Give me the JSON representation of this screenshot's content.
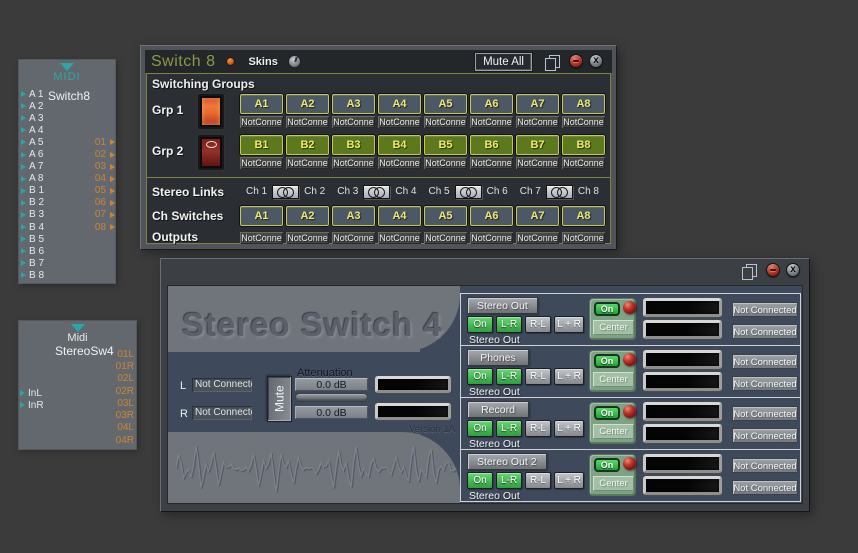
{
  "colors": {
    "desktop_bg": "#3b3b3b",
    "accent_olive": "#7e8140",
    "title_olive": "#8e9747",
    "button_yellow": "#efe96e",
    "group_b_green": "#5c7a1d",
    "channel_slate": "#4d5866",
    "port_teal": "#2aa5a8",
    "port_orange": "#cd8330",
    "panel_navy": "#3e4a5c",
    "window_gray": "#70757c",
    "sage_green": "#7fa285",
    "on_green": "#2f9e3e",
    "knob_red": "#8c0f16",
    "led_orange": "#d2590f"
  },
  "module_midi_switch8": {
    "header": "MIDI",
    "title": "Switch8",
    "rows": [
      {
        "in": "A 1",
        "out": ""
      },
      {
        "in": "A 2",
        "out": ""
      },
      {
        "in": "A 3",
        "out": ""
      },
      {
        "in": "A 4",
        "out": ""
      },
      {
        "in": "A 5",
        "out": "01"
      },
      {
        "in": "A 6",
        "out": "02"
      },
      {
        "in": "A 7",
        "out": "03"
      },
      {
        "in": "A 8",
        "out": "04"
      },
      {
        "in": "B 1",
        "out": "05"
      },
      {
        "in": "B 2",
        "out": "06"
      },
      {
        "in": "B 3",
        "out": "07"
      },
      {
        "in": "B 4",
        "out": "08"
      },
      {
        "in": "B 5",
        "out": ""
      },
      {
        "in": "B 6",
        "out": ""
      },
      {
        "in": "B 7",
        "out": ""
      },
      {
        "in": "B 8",
        "out": ""
      }
    ]
  },
  "module_midi_stereosw4": {
    "header": "Midi",
    "title": "StereoSw4",
    "inputs": [
      {
        "label": "InL"
      },
      {
        "label": "InR"
      }
    ],
    "outputs": [
      {
        "label": "01L"
      },
      {
        "label": "01R"
      },
      {
        "label": "02L"
      },
      {
        "label": "02R"
      },
      {
        "label": "03L"
      },
      {
        "label": "03R"
      },
      {
        "label": "04L"
      },
      {
        "label": "04R"
      }
    ]
  },
  "switch8": {
    "title": "Switch 8",
    "skins_label": "Skins",
    "mute_all_label": "Mute All",
    "sections": {
      "switching_groups": "Switching Groups",
      "grp1": "Grp 1",
      "grp2": "Grp 2",
      "stereo_links": "Stereo Links",
      "ch_switches": "Ch Switches",
      "outputs": "Outputs"
    },
    "channels": [
      {
        "a": "A1",
        "conn_a": "NotConne",
        "b": "B1",
        "conn_b": "NotConne",
        "sw": "A1",
        "conn_out": "NotConne"
      },
      {
        "a": "A2",
        "conn_a": "NotConne",
        "b": "B2",
        "conn_b": "NotConne",
        "sw": "A2",
        "conn_out": "NotConne"
      },
      {
        "a": "A3",
        "conn_a": "NotConne",
        "b": "B3",
        "conn_b": "NotConne",
        "sw": "A3",
        "conn_out": "NotConne"
      },
      {
        "a": "A4",
        "conn_a": "NotConne",
        "b": "B4",
        "conn_b": "NotConne",
        "sw": "A4",
        "conn_out": "NotConne"
      },
      {
        "a": "A5",
        "conn_a": "NotConne",
        "b": "B5",
        "conn_b": "NotConne",
        "sw": "A5",
        "conn_out": "NotConne"
      },
      {
        "a": "A6",
        "conn_a": "NotConne",
        "b": "B6",
        "conn_b": "NotConne",
        "sw": "A6",
        "conn_out": "NotConne"
      },
      {
        "a": "A7",
        "conn_a": "NotConne",
        "b": "B7",
        "conn_b": "NotConne",
        "sw": "A7",
        "conn_out": "NotConne"
      },
      {
        "a": "A8",
        "conn_a": "NotConne",
        "b": "B8",
        "conn_b": "NotConne",
        "sw": "A8",
        "conn_out": "NotConne"
      }
    ],
    "links": [
      {
        "l": "Ch 1",
        "r": "Ch 2"
      },
      {
        "l": "Ch 3",
        "r": "Ch 4"
      },
      {
        "l": "Ch 5",
        "r": "Ch 6"
      },
      {
        "l": "Ch 7",
        "r": "Ch 8"
      }
    ]
  },
  "stereo_switch4": {
    "title": "Stereo Switch 4",
    "version": "Version 1A",
    "left": {
      "l_label": "L",
      "r_label": "R",
      "l_value": "Not Connected",
      "r_value": "Not Connected",
      "mute_label": "Mute",
      "attenuation_label": "Attenuation",
      "atten_l": "0.0 dB",
      "atten_r": "0.0 dB"
    },
    "buses": [
      {
        "name": "Stereo Out",
        "on": "On",
        "lr": "L-R",
        "rl": "R-L",
        "lpr": "L + R",
        "sub": "Stereo Out",
        "center_on": "On",
        "center": "Center",
        "conn_l": "Not Connected",
        "conn_r": "Not Connected"
      },
      {
        "name": "Phones",
        "on": "On",
        "lr": "L-R",
        "rl": "R-L",
        "lpr": "L + R",
        "sub": "Stereo Out",
        "center_on": "On",
        "center": "Center",
        "conn_l": "Not Connected",
        "conn_r": "Not Connected"
      },
      {
        "name": "Record",
        "on": "On",
        "lr": "L-R",
        "rl": "R-L",
        "lpr": "L + R",
        "sub": "Stereo Out",
        "center_on": "On",
        "center": "Center",
        "conn_l": "Not Connected",
        "conn_r": "Not Connected"
      },
      {
        "name": "Stereo Out 2",
        "on": "On",
        "lr": "L-R",
        "rl": "R-L",
        "lpr": "L + R",
        "sub": "Stereo Out",
        "center_on": "On",
        "center": "Center",
        "conn_l": "Not Connected",
        "conn_r": "Not Connected"
      }
    ]
  }
}
